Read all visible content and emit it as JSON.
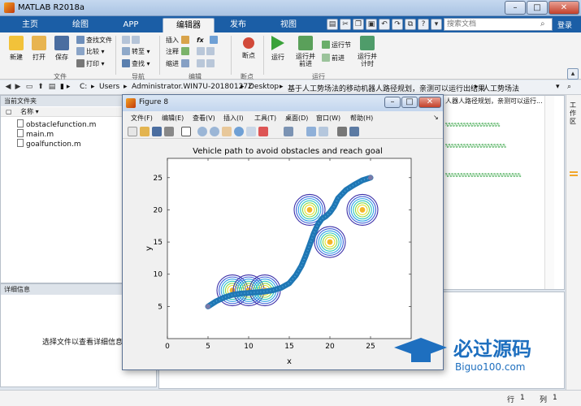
{
  "app": {
    "title": "MATLAB R2018a"
  },
  "tabs": [
    {
      "label": "主页",
      "active": false
    },
    {
      "label": "绘图",
      "active": false
    },
    {
      "label": "APP",
      "active": false
    },
    {
      "label": "编辑器",
      "active": true
    },
    {
      "label": "发布",
      "active": false
    },
    {
      "label": "视图",
      "active": false
    }
  ],
  "search": {
    "placeholder": "搜索文档",
    "login": "登录"
  },
  "ribbon": {
    "new": "新建",
    "open": "打开",
    "save": "保存",
    "find_files": "查找文件",
    "compare": "比较",
    "print": "打印",
    "file_group": "文件",
    "goto": "转至",
    "find": "查找",
    "nav_group": "导航",
    "insert": "插入",
    "comment": "注释",
    "indent": "缩进",
    "fx": "fx",
    "edit_group": "编辑",
    "breakpoints": "断点",
    "bp_group": "断点",
    "run": "运行",
    "run_advance": "运行并\n前进",
    "run_section": "运行节",
    "advance": "前进",
    "run_time": "运行并\n计时",
    "run_group": "运行"
  },
  "address": {
    "parts": [
      "C:",
      "Users",
      "Administrator.WIN7U-20180127Z",
      "Desktop",
      "基于人工势场法的移动机器人路径规划，亲测可以运行出结果",
      "人工势场法"
    ]
  },
  "current_folder": {
    "title": "当前文件夹",
    "column": "名称",
    "files": [
      "obstaclefunction.m",
      "main.m",
      "goalfunction.m"
    ]
  },
  "details": {
    "title": "详细信息",
    "message": "选择文件以查看详细信息"
  },
  "editor": {
    "path_snippet": "人器人路径规划，亲测可以运行...",
    "code_lines": [
      "%%%%%%%%%%%%%%%%%%",
      "%%%%%%%%%%%%%%%%%%%%",
      "%%%%%%%%%%%%%%%%%%%%%%%%%"
    ]
  },
  "right_sidebar": {
    "label": "工作区"
  },
  "status": {
    "row_label": "行",
    "row": "1",
    "col_label": "列",
    "col": "1"
  },
  "figure": {
    "title": "Figure 8",
    "menu": [
      "文件(F)",
      "编辑(E)",
      "查看(V)",
      "插入(I)",
      "工具(T)",
      "桌面(D)",
      "窗口(W)",
      "帮助(H)"
    ]
  },
  "chart_data": {
    "type": "line",
    "title": "Vehicle path to avoid obstacles and reach goal",
    "xlabel": "x",
    "ylabel": "y",
    "xlim": [
      0,
      30
    ],
    "ylim": [
      0,
      28
    ],
    "xticks": [
      0,
      5,
      10,
      15,
      20,
      25
    ],
    "yticks": [
      5,
      10,
      15,
      20,
      25
    ],
    "series": [
      {
        "x": [
          5,
          6,
          7,
          8,
          9,
          10,
          11,
          12,
          13,
          14,
          15,
          15.8,
          16.5,
          17,
          17.5,
          18,
          18.5,
          19,
          19.5,
          20,
          20.5,
          21,
          22,
          23,
          24,
          25
        ],
        "y": [
          5,
          5.8,
          6.4,
          6.8,
          7.0,
          7.1,
          7.2,
          7.3,
          7.5,
          7.9,
          8.6,
          9.8,
          11.3,
          12.8,
          14.5,
          16.3,
          17.7,
          18.6,
          19.0,
          19.6,
          20.5,
          21.8,
          23.1,
          23.9,
          24.6,
          25
        ]
      }
    ],
    "obstacles": [
      {
        "x": 8,
        "y": 7.5
      },
      {
        "x": 10,
        "y": 7.5
      },
      {
        "x": 12,
        "y": 7.5
      },
      {
        "x": 17.5,
        "y": 20
      },
      {
        "x": 24,
        "y": 20
      },
      {
        "x": 20,
        "y": 15
      }
    ],
    "start": {
      "x": 5,
      "y": 5
    },
    "goal": {
      "x": 25,
      "y": 25
    }
  },
  "watermark": {
    "brand": "必过源码",
    "url": "Biguo100.com"
  }
}
